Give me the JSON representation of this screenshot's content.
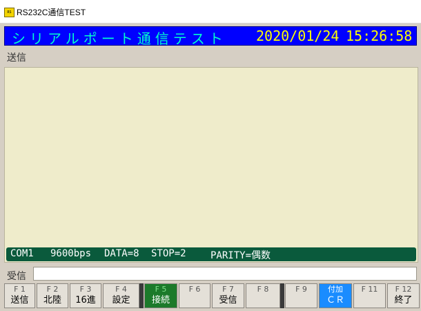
{
  "window": {
    "title": "RS232C通信TEST",
    "icon": "app-icon"
  },
  "header": {
    "title": "シリアルポート通信テスト",
    "date": "2020/01/24",
    "time": "15:26:58"
  },
  "send": {
    "label": "送信"
  },
  "status": {
    "port": "COM1",
    "baud": "9600bps",
    "data": "DATA=8",
    "stop": "STOP=2",
    "parity": "PARITY=偶数"
  },
  "receive": {
    "label": "受信",
    "value": ""
  },
  "fkeys": [
    {
      "num": "F 1",
      "label": "送信"
    },
    {
      "num": "F 2",
      "label": "北陸"
    },
    {
      "num": "F 3",
      "label": "16進"
    },
    {
      "num": "F 4",
      "label": "設定"
    },
    {
      "num": "F 5",
      "label": "接続"
    },
    {
      "num": "F 6",
      "label": ""
    },
    {
      "num": "F 7",
      "label": "受信"
    },
    {
      "num": "F 8",
      "label": ""
    },
    {
      "num": "F 9",
      "label": ""
    },
    {
      "num": "付加",
      "label": "ＣＲ"
    },
    {
      "num": "F 11",
      "label": ""
    },
    {
      "num": "F 12",
      "label": "終了"
    }
  ],
  "colors": {
    "header_bg": "#0000ff",
    "header_title": "#00ffcc",
    "header_clock": "#ffff00",
    "status_bg": "#0a5a3c",
    "send_area_bg": "#efeccb",
    "active_key": "#1c7a2a",
    "toggle_key": "#1a8cff"
  }
}
